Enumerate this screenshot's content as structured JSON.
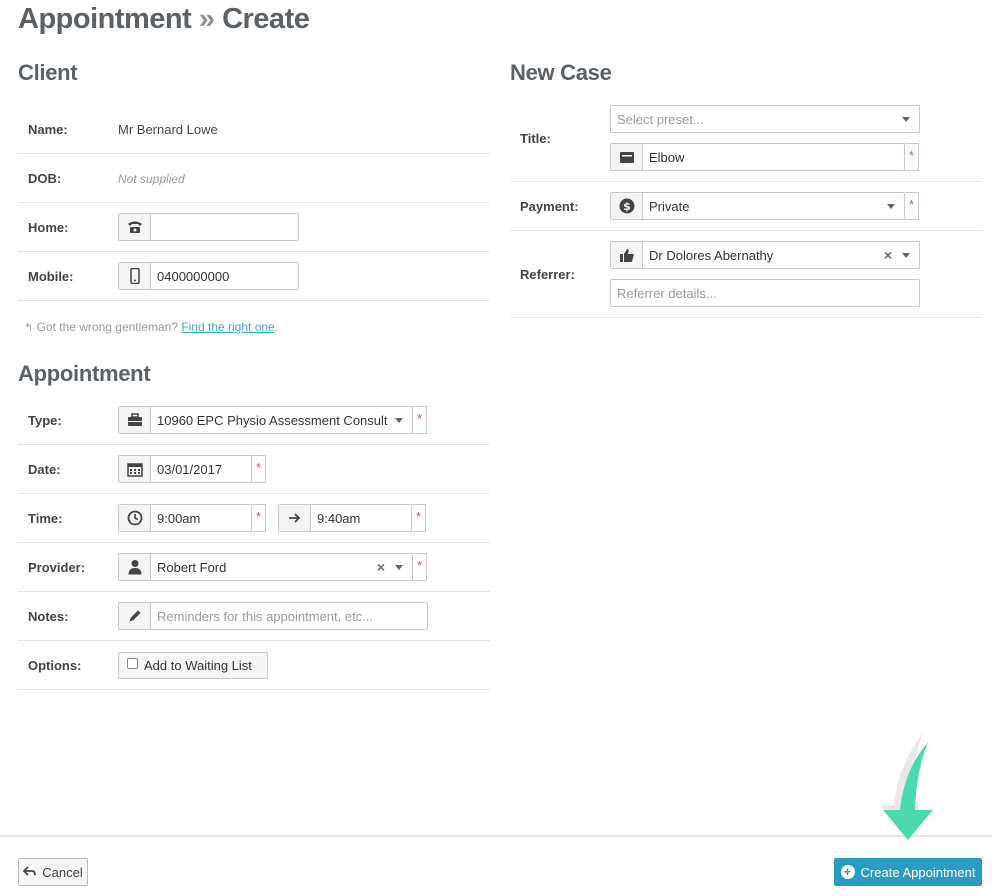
{
  "page": {
    "title_main": "Appointment",
    "title_sep": "»",
    "title_sub": "Create"
  },
  "client": {
    "heading": "Client",
    "name_label": "Name:",
    "name_value": "Mr Bernard Lowe",
    "dob_label": "DOB:",
    "dob_value": "Not supplied",
    "home_label": "Home:",
    "home_value": "",
    "mobile_label": "Mobile:",
    "mobile_value": "0400000000",
    "hint_text": "Got the wrong gentleman?",
    "hint_link": "Find the right one",
    "hint_end": "."
  },
  "appointment": {
    "heading": "Appointment",
    "type_label": "Type:",
    "type_value": "10960 EPC Physio Assessment Consult",
    "date_label": "Date:",
    "date_value": "03/01/2017",
    "time_label": "Time:",
    "time_start": "9:00am",
    "time_end": "9:40am",
    "provider_label": "Provider:",
    "provider_value": "Robert Ford",
    "notes_label": "Notes:",
    "notes_placeholder": "Reminders for this appointment, etc...",
    "options_label": "Options:",
    "waiting_list_label": "Add to Waiting List"
  },
  "new_case": {
    "heading": "New Case",
    "title_label": "Title:",
    "preset_placeholder": "Select preset...",
    "title_value": "Elbow",
    "payment_label": "Payment:",
    "payment_value": "Private",
    "referrer_label": "Referrer:",
    "referrer_value": "Dr Dolores Abernathy",
    "referrer_details_placeholder": "Referrer details..."
  },
  "footer": {
    "cancel_label": "Cancel",
    "create_label": "Create Appointment"
  },
  "required_marker": "*",
  "clear_marker": "×",
  "colors": {
    "primary": "#2a9bc2",
    "required": "#d9534f",
    "arrow": "#4dd9b0",
    "heading": "#5b6166"
  }
}
